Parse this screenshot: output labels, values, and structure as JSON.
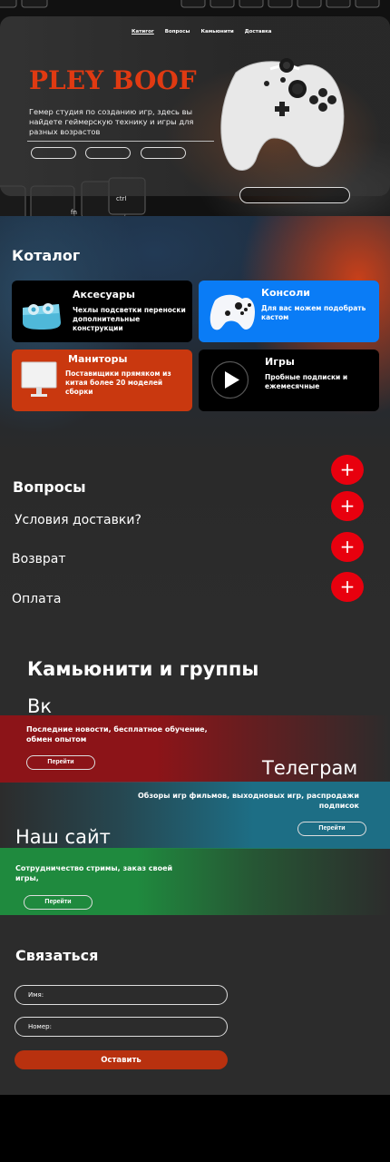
{
  "nav": {
    "items": [
      "Катигог",
      "Вопросы",
      "Камьюнити",
      "Доставка"
    ]
  },
  "hero": {
    "brand": "PLEY BOOF",
    "description": "Гемер студия по созданию игр, здесь вы найдете геймерскую технику и игры для разных возрастов"
  },
  "catalog": {
    "title": "Котaлог",
    "cards": [
      {
        "title": "Аксесуары",
        "desc": "Чехлы подсветки переноски дополнительные конструкции",
        "icon": "earbuds-case-icon",
        "bg": "#000000"
      },
      {
        "title": "Консоли",
        "desc": "Для вас можем подобрать кастом",
        "icon": "gamepad-icon",
        "bg": "#0a7cf6"
      },
      {
        "title": "Маниторы",
        "desc": "Поставищики прямяком из китая более 20 моделей сборки",
        "icon": "monitor-icon",
        "bg": "#c9380f"
      },
      {
        "title": "Игры",
        "desc": "Пробные подписки и ежемесячные",
        "icon": "play-icon",
        "bg": "#000000"
      }
    ]
  },
  "faq": {
    "title": "Вопросы",
    "items": [
      "Условия доставки?",
      "Возврат",
      "Оплата"
    ],
    "plus_symbol": "+"
  },
  "community": {
    "title": "Камьюнити и группы",
    "groups": [
      {
        "name": "Вк",
        "desc": "Последние новости, бесплатное обучение, обмен опытом",
        "button": "Перейти",
        "color": "#8c1418"
      },
      {
        "name": "Телеграм",
        "desc": "Обзоры игр фильмов, выходновых игр, распродажи подписок",
        "button": "Перейти",
        "color": "#1d6e85"
      },
      {
        "name": "Наш сайт",
        "desc": "Сотрудничество стримы, заказ своей игры,",
        "button": "Перейти",
        "color": "#1f8a3e"
      }
    ]
  },
  "contact": {
    "title": "Связаться",
    "name_placeholder": "Имя:",
    "phone_placeholder": "Номер:",
    "submit": "Оставить"
  },
  "colors": {
    "accent_red": "#e8000e",
    "brand_orange": "#e03a12",
    "submit": "#b8310f",
    "console_blue": "#0a7cf6"
  }
}
